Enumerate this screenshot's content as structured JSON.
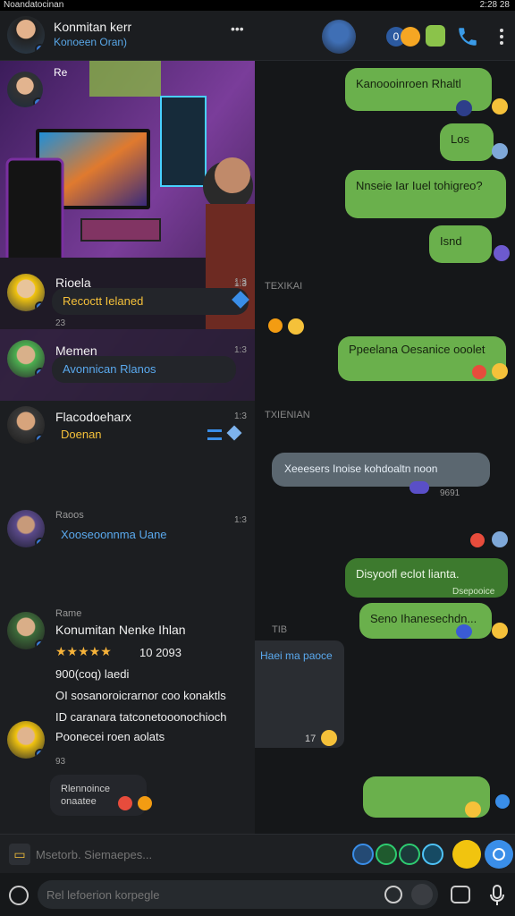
{
  "status": {
    "carrier": "Noandatocinan",
    "time": "2:28 28"
  },
  "header": {
    "title": "Konmitan kerr",
    "subtitle": "Konoeen Oran)",
    "menu_label": "•••",
    "counter": "0"
  },
  "chats": {
    "photo_label": "Re",
    "photo_time": "1:3",
    "items": [
      {
        "name": "Rioela",
        "preview": "Recoctt Ielaned",
        "time": "1:3",
        "sub": "23"
      },
      {
        "name": "Memen",
        "preview": "Avonnican Rlanos",
        "time": "1:3",
        "sub": ""
      },
      {
        "name": "Flacodoeharx",
        "preview": "Doenan",
        "time": "1:3",
        "sub": ""
      },
      {
        "name": "Raoos",
        "preview": "Xooseoonnma Uane",
        "time": "1:3",
        "sub": ""
      }
    ],
    "detail": {
      "author": "Rame",
      "title": "Konumitan Nenke Ihlan",
      "stars": "★★★★★",
      "rating": "10 2093",
      "price": "900(coq) laedi",
      "line1": "OI sosanoroicrarnor coo konaktls",
      "line2": "ID caranara tatconetooonochioch",
      "line3": "Poonecei roen aolats",
      "count": "93",
      "tag_line1": "Rlennoince",
      "tag_line2": "onaatee"
    }
  },
  "messages": {
    "out1": "Kanoooinroen Rhaltl",
    "out2": "Los",
    "out3": "Nnseie Iar Iuel tohigreo?",
    "out4": "Isnd",
    "sys1": "TEXIKAI",
    "out5": "Ppeelana Oesanice ooolet",
    "sys2": "TXIENIAN",
    "in1": "Xeeesers Inoise kohdoaltn noon",
    "in1_time": "9691",
    "out6": "Disyoofl eclot lianta.",
    "out6_caption": "Dsepooice",
    "out7": "Seno Ihanesechdn...",
    "sys3": "TIB",
    "card_title": "Haei ma paoce",
    "card_count": "17"
  },
  "composer": {
    "placeholder": "Msetorb. Siemaepes..."
  },
  "bottom": {
    "placeholder": "Rel lefoerion korpegle"
  },
  "colors": {
    "bubble_out": "#6ab04c",
    "bubble_in": "#5b6770",
    "accent": "#3a7bd5",
    "header_bg": "#1b1d20"
  }
}
